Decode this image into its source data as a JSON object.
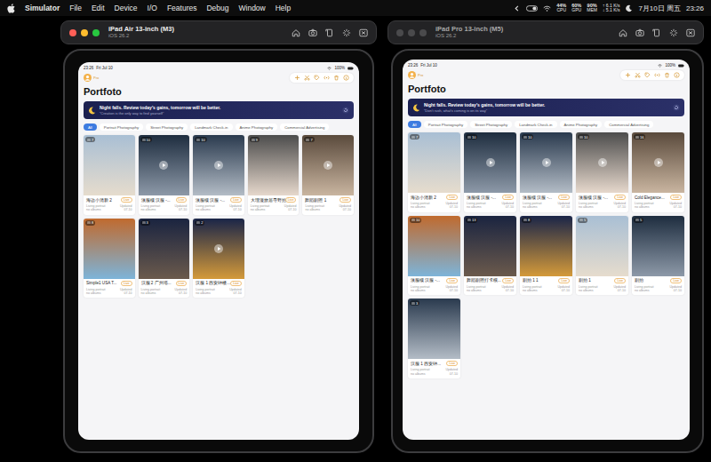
{
  "menubar": {
    "app": "Simulator",
    "items": [
      "File",
      "Edit",
      "Device",
      "I/O",
      "Features",
      "Debug",
      "Window",
      "Help"
    ],
    "stats": [
      {
        "value": "44%",
        "label": "CPU"
      },
      {
        "value": "60%",
        "label": "GPU"
      },
      {
        "value": "90%",
        "label": "MEM"
      }
    ],
    "network": {
      "up": "↑ 6.1 K/s",
      "down": "↓ 5.1 K/s"
    },
    "date": "7月10日 周五",
    "time": "23:26"
  },
  "windows": [
    {
      "title": "iPad Air 13-inch (M3)",
      "subtitle": "iOS 26.2",
      "focused": true,
      "screen": {
        "time": "23:26",
        "date": "Fri Jul 10",
        "battery": "100%",
        "avatar": "Pro",
        "app_title": "Portfoto",
        "banner": {
          "title": "Night falls. Review today's gains, tomorrow will be better.",
          "subtitle": "“Creation is the only way to find yourself”"
        },
        "tabs": [
          {
            "label": "All",
            "selected": true
          },
          {
            "label": "Portrait Photography",
            "selected": false
          },
          {
            "label": "Street Photography",
            "selected": false
          },
          {
            "label": "Landmark Check-in",
            "selected": false
          },
          {
            "label": "Anime Photography",
            "selected": false
          },
          {
            "label": "Commercial Advertising",
            "selected": false
          }
        ],
        "cards": [
          {
            "title": "海边小清新 2",
            "count": "7",
            "tag": "Live",
            "video": false,
            "meta": [
              "Living portrait",
              "no albums"
            ],
            "side": [
              "Updated",
              "07-10"
            ]
          },
          {
            "title": "漢服樓 汉服 -...",
            "count": "10",
            "tag": "Live",
            "video": true,
            "meta": [
              "Living portrait",
              "no albums"
            ],
            "side": [
              "Updated",
              "07-10"
            ]
          },
          {
            "title": "漢服樓 汉服 -...",
            "count": "10",
            "tag": "Live",
            "video": true,
            "meta": [
              "Living portrait",
              "no albums"
            ],
            "side": [
              "Updated",
              "07-10"
            ]
          },
          {
            "title": "大理漫旅居寻野拍",
            "count": "9",
            "tag": "Live",
            "video": false,
            "meta": [
              "Living portrait",
              "no albums"
            ],
            "side": [
              "Updated",
              "07-10"
            ]
          },
          {
            "title": "舞蹈剧照 1",
            "count": "7",
            "tag": "Live",
            "video": true,
            "meta": [
              "Living portrait",
              "no albums"
            ],
            "side": [
              "Updated",
              "07-10"
            ]
          },
          {
            "title": "Simple1 USA T...",
            "count": "8",
            "tag": "Live",
            "video": false,
            "meta": [
              "Living portrait",
              "no albums"
            ],
            "side": [
              "Updated",
              "07-10"
            ]
          },
          {
            "title": "汉服 2 广州塔...",
            "count": "3",
            "tag": "Live",
            "video": false,
            "meta": [
              "Living portrait",
              "no albums"
            ],
            "side": [
              "Updated",
              "07-10"
            ]
          },
          {
            "title": "汉服 1 西安钟楼...",
            "count": "2",
            "tag": "Live",
            "video": true,
            "meta": [
              "Living portrait",
              "no albums"
            ],
            "side": [
              "Updated",
              "07-10"
            ]
          }
        ]
      }
    },
    {
      "title": "iPad Pro 13-inch (M5)",
      "subtitle": "iOS 26.2",
      "focused": false,
      "screen": {
        "time": "23:26",
        "date": "Fri Jul 10",
        "battery": "100%",
        "avatar": "Pro",
        "app_title": "Portfoto",
        "banner": {
          "title": "Night falls. Review today's gains, tomorrow will be better.",
          "subtitle": "“Don't rush, what's coming is on its way”"
        },
        "tabs": [
          {
            "label": "All",
            "selected": true
          },
          {
            "label": "Portrait Photography",
            "selected": false
          },
          {
            "label": "Street Photography",
            "selected": false
          },
          {
            "label": "Landmark Check-in",
            "selected": false
          },
          {
            "label": "Anime Photography",
            "selected": false
          },
          {
            "label": "Commercial Advertising",
            "selected": false
          }
        ],
        "cards": [
          {
            "title": "海边小清新 2",
            "count": "7",
            "tag": "Live",
            "video": false,
            "meta": [
              "Living portrait",
              "no albums"
            ],
            "side": [
              "Updated",
              "07-10"
            ]
          },
          {
            "title": "漢服樓 汉服 -...",
            "count": "10",
            "tag": "Live",
            "video": true,
            "meta": [
              "Living portrait",
              "no albums"
            ],
            "side": [
              "Updated",
              "07-10"
            ]
          },
          {
            "title": "漢服樓 汉服 -...",
            "count": "10",
            "tag": "Live",
            "video": true,
            "meta": [
              "Living portrait",
              "no albums"
            ],
            "side": [
              "Updated",
              "07-10"
            ]
          },
          {
            "title": "漢服樓 汉服 -...",
            "count": "10",
            "tag": "Live",
            "video": true,
            "meta": [
              "Living portrait",
              "no albums"
            ],
            "side": [
              "Updated",
              "07-10"
            ]
          },
          {
            "title": "Cold Elegance...",
            "count": "16",
            "tag": "Live",
            "video": true,
            "meta": [
              "Living portrait",
              "no albums"
            ],
            "side": [
              "Updated",
              "07-10"
            ]
          },
          {
            "title": "漢服樓 汉服 -...",
            "count": "10",
            "tag": "Live",
            "video": false,
            "meta": [
              "Living portrait",
              "no albums"
            ],
            "side": [
              "Updated",
              "07-10"
            ]
          },
          {
            "title": "舞蹈剧照打卡模...",
            "count": "13",
            "tag": "Live",
            "video": false,
            "meta": [
              "Living portrait",
              "no albums"
            ],
            "side": [
              "Updated",
              "07-10"
            ]
          },
          {
            "title": "剧拍 1 1",
            "count": "8",
            "tag": "Live",
            "video": false,
            "meta": [
              "Living portrait",
              "no albums"
            ],
            "side": [
              "Updated",
              "07-10"
            ]
          },
          {
            "title": "剧拍 1",
            "count": "5",
            "tag": "Live",
            "video": false,
            "meta": [
              "Living portrait",
              "no albums"
            ],
            "side": [
              "Updated",
              "07-10"
            ]
          },
          {
            "title": "剧拍",
            "count": "5",
            "tag": "Live",
            "video": false,
            "meta": [
              "Living portrait",
              "no albums"
            ],
            "side": [
              "Updated",
              "07-10"
            ]
          },
          {
            "title": "汉服 1 西安钟...",
            "count": "3",
            "tag": "Live",
            "video": false,
            "meta": [
              "Living portrait",
              "no albums"
            ],
            "side": [
              "Updated",
              "07-10"
            ]
          }
        ]
      }
    }
  ]
}
